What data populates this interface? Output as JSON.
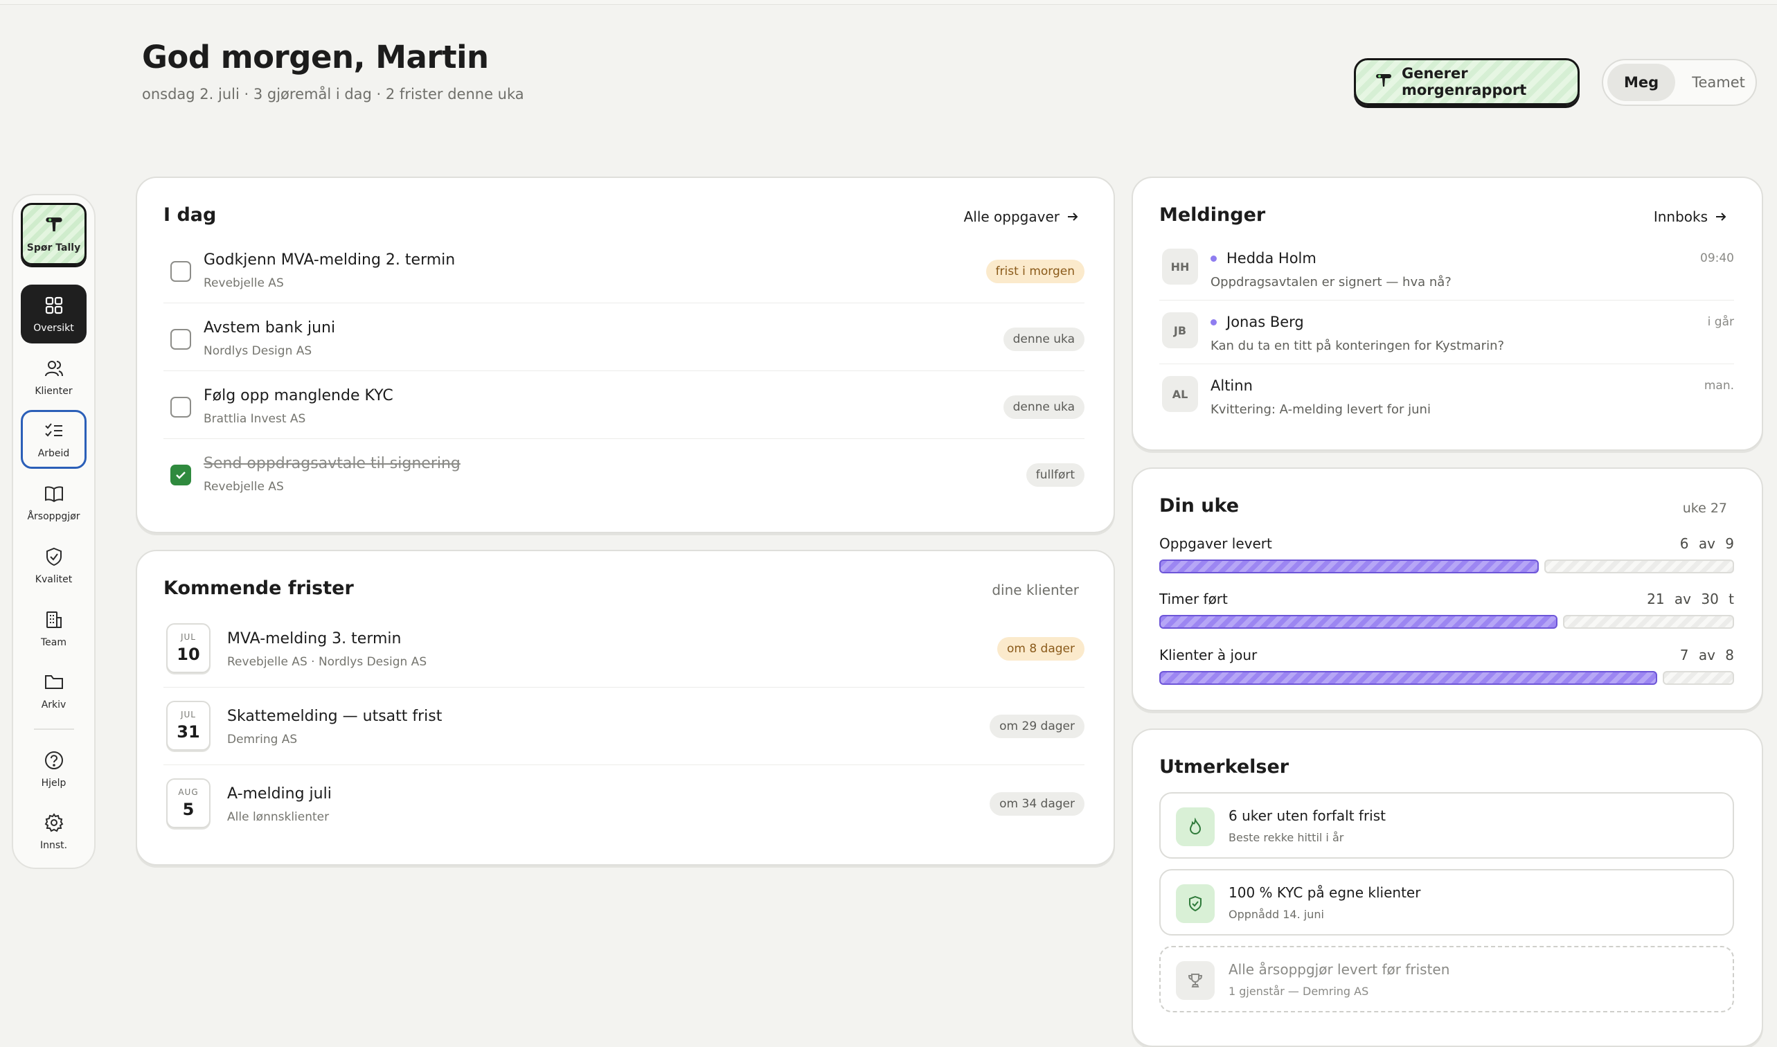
{
  "header": {
    "greeting": "God morgen, Martin",
    "subline": "onsdag 2. juli · 3 gjøremål i dag · 2 frister denne uka",
    "generate_button": "Generer morgenrapport",
    "view_toggle": {
      "me": "Meg",
      "team": "Teamet",
      "selected": "Meg"
    }
  },
  "sidebar": {
    "ask": "Spør Tally",
    "items": [
      {
        "label": "Oversikt",
        "icon": "grid-icon",
        "active": true
      },
      {
        "label": "Klienter",
        "icon": "users-icon"
      },
      {
        "label": "Arbeid",
        "icon": "checklist-icon",
        "focused": true
      },
      {
        "label": "Årsoppgjør",
        "icon": "book-icon"
      },
      {
        "label": "Kvalitet",
        "icon": "shield-check-icon"
      },
      {
        "label": "Team",
        "icon": "building-icon"
      },
      {
        "label": "Arkiv",
        "icon": "folder-icon"
      }
    ],
    "bottom": [
      {
        "label": "Hjelp",
        "icon": "help-icon"
      },
      {
        "label": "Innst.",
        "icon": "gear-icon"
      }
    ]
  },
  "today": {
    "title": "I dag",
    "link": "Alle oppgaver",
    "tasks": [
      {
        "title": "Godkjenn MVA-melding 2. termin",
        "client": "Revebjelle AS",
        "badge": "frist i morgen",
        "done": false
      },
      {
        "title": "Avstem bank juni",
        "client": "Nordlys Design AS",
        "badge": "denne uka",
        "done": false
      },
      {
        "title": "Følg opp manglende KYC",
        "client": "Brattlia Invest AS",
        "badge": "denne uka",
        "done": false
      },
      {
        "title": "Send oppdragsavtale til signering",
        "client": "Revebjelle AS",
        "badge": "fullført",
        "done": true
      }
    ]
  },
  "deadlines": {
    "title": "Kommende frister",
    "filter": "dine klienter",
    "items": [
      {
        "month": "JUL",
        "day": "10",
        "title": "MVA-melding 3. termin",
        "clients": "Revebjelle AS · Nordlys Design AS",
        "badge": "om 8 dager"
      },
      {
        "month": "JUL",
        "day": "31",
        "title": "Skattemelding — utsatt frist",
        "clients": "Demring AS",
        "badge": "om 29 dager"
      },
      {
        "month": "AUG",
        "day": "5",
        "title": "A-melding juli",
        "clients": "Alle lønnsklienter",
        "badge": "om 34 dager"
      }
    ]
  },
  "messages": {
    "title": "Meldinger",
    "link": "Innboks",
    "items": [
      {
        "initials": "HH",
        "name": "Hedda Holm",
        "text": "Oppdragsavtalen er signert — hva nå?",
        "time": "09:40",
        "unread": true
      },
      {
        "initials": "JB",
        "name": "Jonas Berg",
        "text": "Kan du ta en titt på konteringen for Kystmarin?",
        "time": "i går",
        "unread": true
      },
      {
        "initials": "AL",
        "name": "Altinn",
        "text": "Kvittering: A-melding levert for juni",
        "time": "man.",
        "unread": false
      }
    ]
  },
  "week": {
    "title": "Din uke",
    "week_label": "uke 27",
    "metrics": [
      {
        "label": "Oppgaver levert",
        "value": "6 av 9",
        "fraction": 0.667
      },
      {
        "label": "Timer ført",
        "value": "21 av 30 t",
        "fraction": 0.7
      },
      {
        "label": "Klienter à jour",
        "value": "7 av 8",
        "fraction": 0.875
      }
    ]
  },
  "achievements": {
    "title": "Utmerkelser",
    "items": [
      {
        "title": "6 uker uten forfalt frist",
        "sub": "Beste rekke hittil i år",
        "icon": "flame-icon",
        "locked": false
      },
      {
        "title": "100 % KYC på egne klienter",
        "sub": "Oppnådd 14. juni",
        "icon": "shield-check-icon",
        "locked": false
      },
      {
        "title": "Alle årsoppgjør levert før fristen",
        "sub": "1 gjenstår — Demring AS",
        "icon": "trophy-icon",
        "locked": true
      }
    ]
  },
  "colors": {
    "accent_green": "#2f8a3e",
    "progress_purple": "#9c86f2",
    "warn_badge": "#fbeacc",
    "focus_blue": "#2b5fb8"
  }
}
